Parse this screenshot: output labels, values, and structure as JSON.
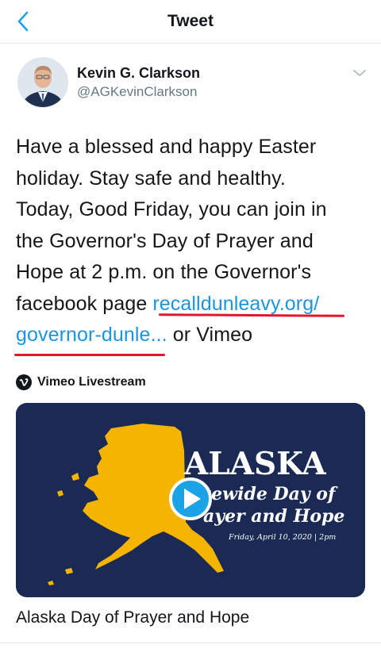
{
  "nav": {
    "title": "Tweet"
  },
  "author": {
    "name": "Kevin G. Clarkson",
    "handle": "@AGKevinClarkson"
  },
  "tweet": {
    "lines": [
      "Have a blessed and happy Easter",
      "holiday.  Stay safe and healthy.",
      "Today, Good Friday, you can join in",
      "the Governor's Day of Prayer and",
      "Hope at 2 p.m. on the Governor's"
    ],
    "line6_prefix": "facebook page ",
    "link_part1": "recalldunleavy.org/",
    "link_part2": "governor-dunle...",
    "line7_suffix": " or Vimeo"
  },
  "embed": {
    "source": "Vimeo Livestream",
    "title": "Alaska Day of Prayer and Hope",
    "thumbnail": {
      "headline": "ALASKA",
      "line1": "tewide Day of",
      "line2": "ayer and Hope",
      "date": "Friday, April 10, 2020 | 2pm"
    }
  },
  "colors": {
    "link": "#1b95e0",
    "underline_mark": "#e1172e",
    "card_background": "#1a2a55",
    "map_gold": "#f5b400",
    "play_button": "#1aa3e6"
  }
}
